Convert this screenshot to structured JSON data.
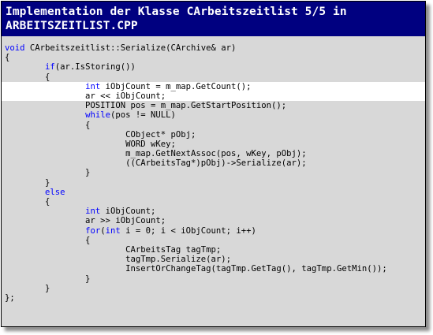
{
  "slide": {
    "title_line1": "Implementation der Klasse CArbeitszeitlist 5/5 in",
    "title_line2": "ARBEITSZEITLIST.CPP"
  },
  "code_lines": [
    {
      "segments": [
        {
          "t": "void",
          "kw": true
        },
        {
          "t": " CArbeitszeitlist::Serialize(CArchive& ar)",
          "kw": false
        }
      ],
      "highlight": false
    },
    {
      "segments": [
        {
          "t": "{",
          "kw": false
        }
      ],
      "highlight": false
    },
    {
      "segments": [
        {
          "t": "        ",
          "kw": false
        },
        {
          "t": "if",
          "kw": true
        },
        {
          "t": "(ar.IsStoring())",
          "kw": false
        }
      ],
      "highlight": false
    },
    {
      "segments": [
        {
          "t": "        {",
          "kw": false
        }
      ],
      "highlight": false
    },
    {
      "segments": [
        {
          "t": "                ",
          "kw": false
        },
        {
          "t": "int",
          "kw": true
        },
        {
          "t": " iObjCount = m_map.GetCount();",
          "kw": false
        }
      ],
      "highlight": true
    },
    {
      "segments": [
        {
          "t": "                ar << iObjCount;",
          "kw": false
        }
      ],
      "highlight": true
    },
    {
      "segments": [
        {
          "t": "                POSITION pos = m_map.GetStartPosition();",
          "kw": false
        }
      ],
      "highlight": false
    },
    {
      "segments": [
        {
          "t": "                ",
          "kw": false
        },
        {
          "t": "while",
          "kw": true
        },
        {
          "t": "(pos != NULL)",
          "kw": false
        }
      ],
      "highlight": false
    },
    {
      "segments": [
        {
          "t": "                {",
          "kw": false
        }
      ],
      "highlight": false
    },
    {
      "segments": [
        {
          "t": "                        CObject* pObj;",
          "kw": false
        }
      ],
      "highlight": false
    },
    {
      "segments": [
        {
          "t": "                        WORD wKey;",
          "kw": false
        }
      ],
      "highlight": false
    },
    {
      "segments": [
        {
          "t": "                        m_map.GetNextAssoc(pos, wKey, pObj);",
          "kw": false
        }
      ],
      "highlight": false
    },
    {
      "segments": [
        {
          "t": "                        ((CArbeitsTag*)pObj)->Serialize(ar);",
          "kw": false
        }
      ],
      "highlight": false
    },
    {
      "segments": [
        {
          "t": "                }",
          "kw": false
        }
      ],
      "highlight": false
    },
    {
      "segments": [
        {
          "t": "        }",
          "kw": false
        }
      ],
      "highlight": false
    },
    {
      "segments": [
        {
          "t": "        ",
          "kw": false
        },
        {
          "t": "else",
          "kw": true
        }
      ],
      "highlight": false
    },
    {
      "segments": [
        {
          "t": "        {",
          "kw": false
        }
      ],
      "highlight": false
    },
    {
      "segments": [
        {
          "t": "                ",
          "kw": false
        },
        {
          "t": "int",
          "kw": true
        },
        {
          "t": " iObjCount;",
          "kw": false
        }
      ],
      "highlight": false
    },
    {
      "segments": [
        {
          "t": "                ar >> iObjCount;",
          "kw": false
        }
      ],
      "highlight": false
    },
    {
      "segments": [
        {
          "t": "                ",
          "kw": false
        },
        {
          "t": "for",
          "kw": true
        },
        {
          "t": "(",
          "kw": false
        },
        {
          "t": "int",
          "kw": true
        },
        {
          "t": " i = 0; i < iObjCount; i++)",
          "kw": false
        }
      ],
      "highlight": false
    },
    {
      "segments": [
        {
          "t": "                {",
          "kw": false
        }
      ],
      "highlight": false
    },
    {
      "segments": [
        {
          "t": "                        CArbeitsTag tagTmp;",
          "kw": false
        }
      ],
      "highlight": false
    },
    {
      "segments": [
        {
          "t": "                        tagTmp.Serialize(ar);",
          "kw": false
        }
      ],
      "highlight": false
    },
    {
      "segments": [
        {
          "t": "                        InsertOrChangeTag(tagTmp.GetTag(), tagTmp.GetMin());",
          "kw": false
        }
      ],
      "highlight": false
    },
    {
      "segments": [
        {
          "t": "                }",
          "kw": false
        }
      ],
      "highlight": false
    },
    {
      "segments": [
        {
          "t": "        }",
          "kw": false
        }
      ],
      "highlight": false
    },
    {
      "segments": [
        {
          "t": "};",
          "kw": false
        }
      ],
      "highlight": false
    }
  ],
  "colors": {
    "header_bg": "#000080",
    "header_text": "#ffffff",
    "code_bg": "#d8d8d8",
    "keyword": "#0000ff",
    "highlight_bg": "#ffffff"
  }
}
